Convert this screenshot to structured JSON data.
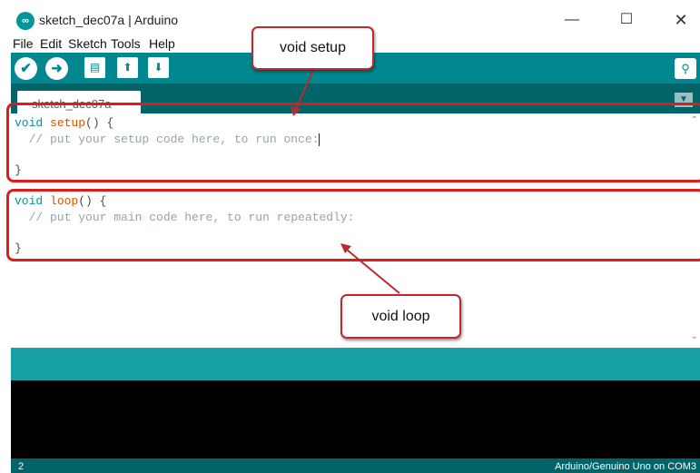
{
  "window": {
    "logo_glyph": "∞",
    "title": "sketch_dec07a | Arduino",
    "minimize_glyph": "—",
    "maximize_glyph": "☐",
    "close_glyph": "✕"
  },
  "menu": [
    "File",
    "Edit",
    "Sketch",
    "Tools",
    "Help"
  ],
  "toolbar": {
    "verify_icon": "check-icon",
    "upload_icon": "arrow-right-icon",
    "new_icon": "new-file-icon",
    "open_icon": "arrow-up-icon",
    "save_icon": "arrow-down-icon",
    "serial_monitor_icon": "magnifier-icon"
  },
  "tab": {
    "label": "sketch_dec07a"
  },
  "code": {
    "setup_keyword": "void",
    "setup_name": "setup",
    "setup_rest": "() {",
    "setup_comment": "  // put your setup code here, to run once:",
    "setup_close": "}",
    "loop_keyword": "void",
    "loop_name": "loop",
    "loop_rest": "() {",
    "loop_comment": "  // put your main code here, to run repeatedly:",
    "loop_close": "}"
  },
  "callouts": {
    "setup": "void setup",
    "loop": "void loop"
  },
  "status": {
    "line_number": "2",
    "board": "Arduino/Genuino Uno on COM3"
  },
  "colors": {
    "toolbar": "#00878f",
    "tabstrip": "#006468",
    "message_bar": "#17a1a5",
    "console": "#000000",
    "highlight": "#e01b1b"
  }
}
